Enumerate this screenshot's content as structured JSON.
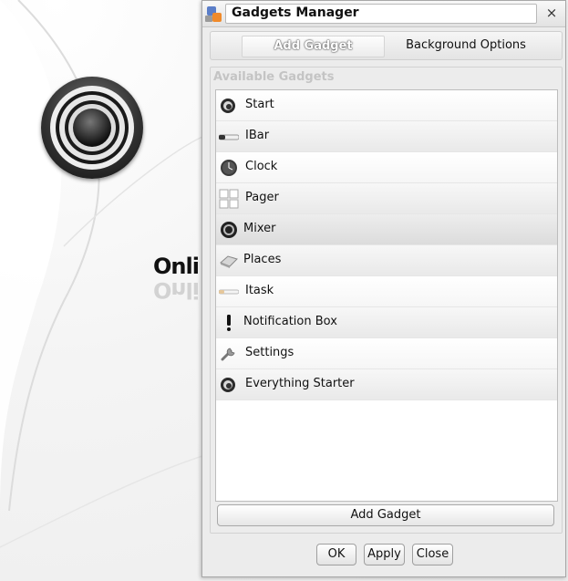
{
  "desktop": {
    "logo_text": "Onli"
  },
  "window": {
    "title": "Gadgets Manager",
    "close_glyph": "×",
    "tabs": [
      {
        "label": "Add Gadget",
        "active": true
      },
      {
        "label": "Background Options",
        "active": false
      }
    ],
    "group_label": "Available Gadgets",
    "gadgets": [
      {
        "label": "Start",
        "icon": "start-icon"
      },
      {
        "label": "IBar",
        "icon": "ibar-icon"
      },
      {
        "label": "Clock",
        "icon": "clock-icon"
      },
      {
        "label": "Pager",
        "icon": "pager-icon"
      },
      {
        "label": "Mixer",
        "icon": "mixer-icon",
        "selected": true
      },
      {
        "label": "Places",
        "icon": "places-icon"
      },
      {
        "label": "Itask",
        "icon": "itask-icon"
      },
      {
        "label": "Notification Box",
        "icon": "notification-icon"
      },
      {
        "label": "Settings",
        "icon": "settings-icon"
      },
      {
        "label": "Everything Starter",
        "icon": "everything-icon"
      }
    ],
    "add_button": "Add Gadget",
    "buttons": {
      "ok": "OK",
      "apply": "Apply",
      "close": "Close"
    }
  },
  "colors": {
    "window_bg": "#ececec",
    "selected_row": "#dcdcdc",
    "disabled_label": "#c4c4c4"
  }
}
